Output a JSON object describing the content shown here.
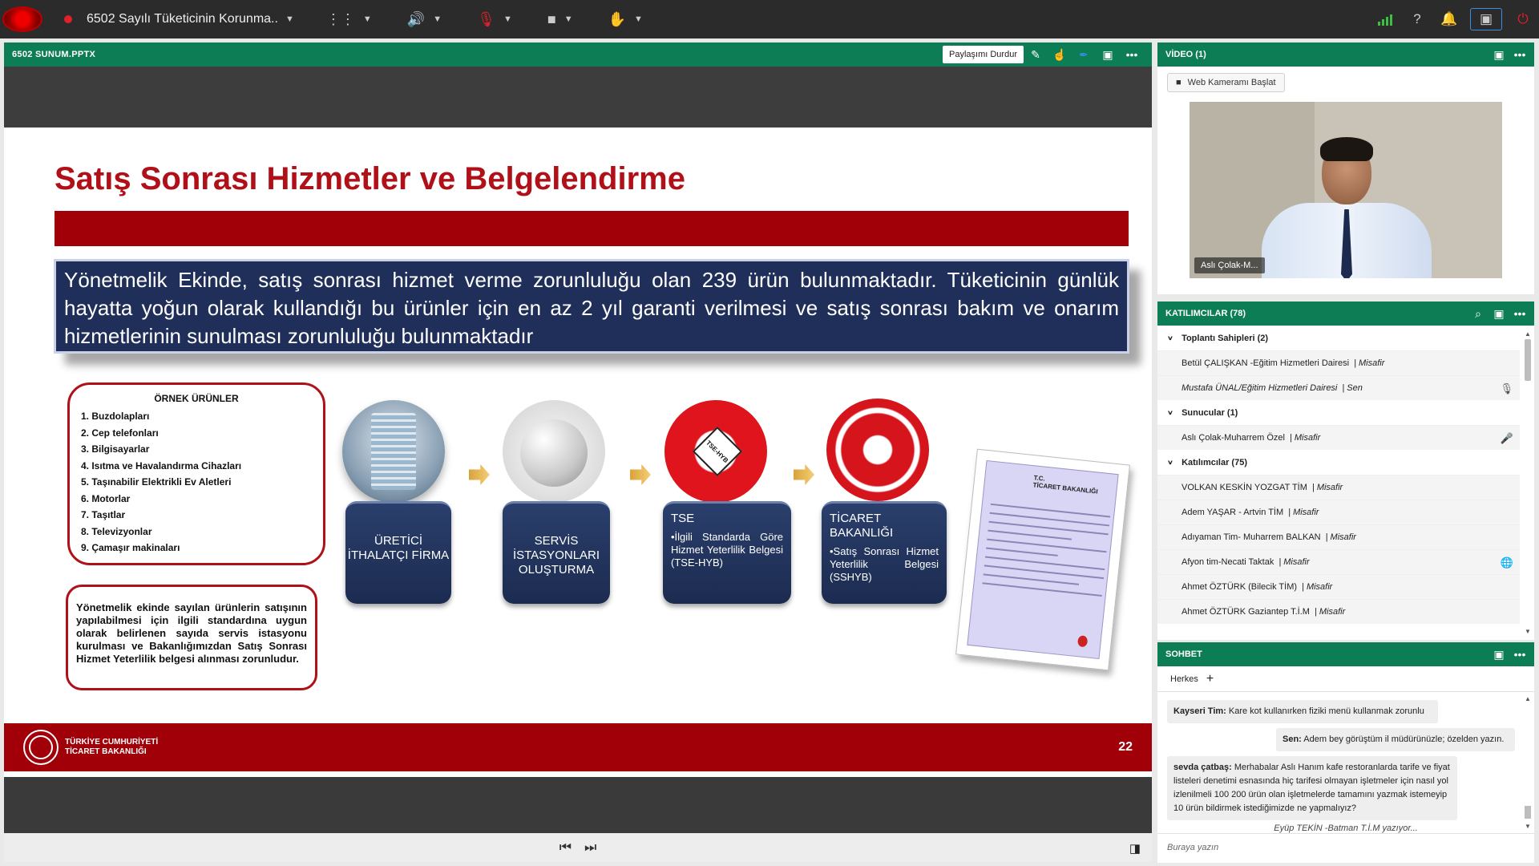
{
  "topbar": {
    "meeting_title": "6502 Sayılı Tüketicinin Korunma...",
    "icons": [
      "connect-logo",
      "recording-dot",
      "apps-grid-icon",
      "speaker-icon",
      "microphone-muted-icon",
      "camera-icon",
      "raise-hand-icon",
      "signal-icon",
      "help-icon",
      "notification-bell-icon",
      "fullscreen-icon",
      "power-icon"
    ]
  },
  "share": {
    "pod_title": "6502 SUNUM.PPTX",
    "stop_label": "Paylaşımı Durdur"
  },
  "slide": {
    "title": "Satış Sonrası Hizmetler ve Belgelendirme",
    "info_text": "Yönetmelik Ekinde, satış sonrası hizmet verme zorunluluğu olan 239 ürün bulunmaktadır. Tüketicinin günlük hayatta yoğun olarak kullandığı bu ürünler için en az 2 yıl garanti verilmesi ve satış sonrası bakım ve onarım hizmetlerinin sunulması zorunluluğu bulunmaktadır",
    "products_title": "ÖRNEK ÜRÜNLER",
    "products": [
      "1. Buzdolapları",
      "2. Cep telefonları",
      "3. Bilgisayarlar",
      "4. Isıtma ve Havalandırma Cihazları",
      "5. Taşınabilir Elektrikli Ev Aletleri",
      "6. Motorlar",
      "7. Taşıtlar",
      "8. Televizyonlar",
      "9. Çamaşır makinaları"
    ],
    "rule_text": "Yönetmelik ekinde sayılan ürünlerin satışının yapılabilmesi için ilgili standardına uygun olarak belirlenen sayıda servis istasyonu kurulması ve Bakanlığımızdan Satış Sonrası Hizmet Yeterlilik belgesi alınması zorunludur.",
    "stage1": "ÜRETİCİ İTHALATÇI FİRMA",
    "stage2": "SERVİS İSTASYONLARI OLUŞTURMA",
    "stage3_head": "TSE",
    "stage3_body": "•İlgili Standarda Göre Hizmet Yeterlilik Belgesi (TSE-HYB)",
    "stage4_head": "TİCARET BAKANLIĞI",
    "stage4_body": "•Satış Sonrası Hizmet Yeterlilik Belgesi (SSHYB)",
    "tse_badge": "TSE-HYB",
    "doc_line1": "T.C.",
    "doc_line2": "TİCARET BAKANLIĞI",
    "footer_line1": "TÜRKİYE CUMHURİYETİ",
    "footer_line2": "TİCARET BAKANLIĞI",
    "page_number": "22"
  },
  "video": {
    "header": "VİDEO (1)",
    "cam_button": "Web Kameramı Başlat",
    "participant_label": "Aslı Çolak-M..."
  },
  "participants": {
    "header": "KATILIMCILAR  (78)",
    "groups": {
      "hosts": "Toplantı Sahipleri (2)",
      "presenters": "Sunucular (1)",
      "attendees": "Katılımcılar (75)"
    },
    "hosts": [
      {
        "name": "Betül ÇALIŞKAN -Eğitim Hizmetleri Dairesi",
        "role": "| Misafir"
      },
      {
        "name": "Mustafa ÜNAL/Eğitim Hizmetleri Dairesi",
        "role": "| Sen"
      }
    ],
    "presenters": [
      {
        "name": "Aslı Çolak-Muharrem Özel",
        "role": "| Misafir"
      }
    ],
    "attendees": [
      {
        "name": "VOLKAN KESKİN YOZGAT TİM",
        "role": "| Misafir"
      },
      {
        "name": "Adem YAŞAR - Artvin TİM",
        "role": "| Misafir"
      },
      {
        "name": "Adıyaman Tim- Muharrem BALKAN",
        "role": "| Misafir"
      },
      {
        "name": "Afyon tim-Necati Taktak",
        "role": "| Misafir"
      },
      {
        "name": "Ahmet ÖZTÜRK (Bilecik TİM)",
        "role": "| Misafir"
      },
      {
        "name": "Ahmet ÖZTÜRK Gaziantep T.İ.M",
        "role": "| Misafir"
      }
    ]
  },
  "chat": {
    "header": "SOHBET",
    "tab": "Herkes",
    "messages": [
      {
        "sender": "Kayseri Tim:",
        "text": "Kare kot kullanırken fiziki menü kullanmak zorunlu"
      },
      {
        "sender": "Sen:",
        "text": "Adem bey görüştüm il müdürünüzle; özelden yazın."
      },
      {
        "sender": "sevda çatbaş:",
        "text": "Merhabalar Aslı Hanım kafe restoranlarda  tarife ve fiyat listeleri denetimi esnasında hiç tarifesi olmayan işletmeler için nasıl yol izlenilmeli  100 200 ürün olan işletmelerde  tamamını yazmak istemeyip 10 ürün bildirmek istediğimizde ne yapmalıyız?"
      }
    ],
    "typing": "Eyüp TEKİN -Batman T.İ.M yazıyor...",
    "input_placeholder": "Buraya yazın"
  },
  "colors": {
    "accent_green": "#0d7d55",
    "slide_red": "#a10008",
    "slide_navy": "#1f2f5a"
  }
}
